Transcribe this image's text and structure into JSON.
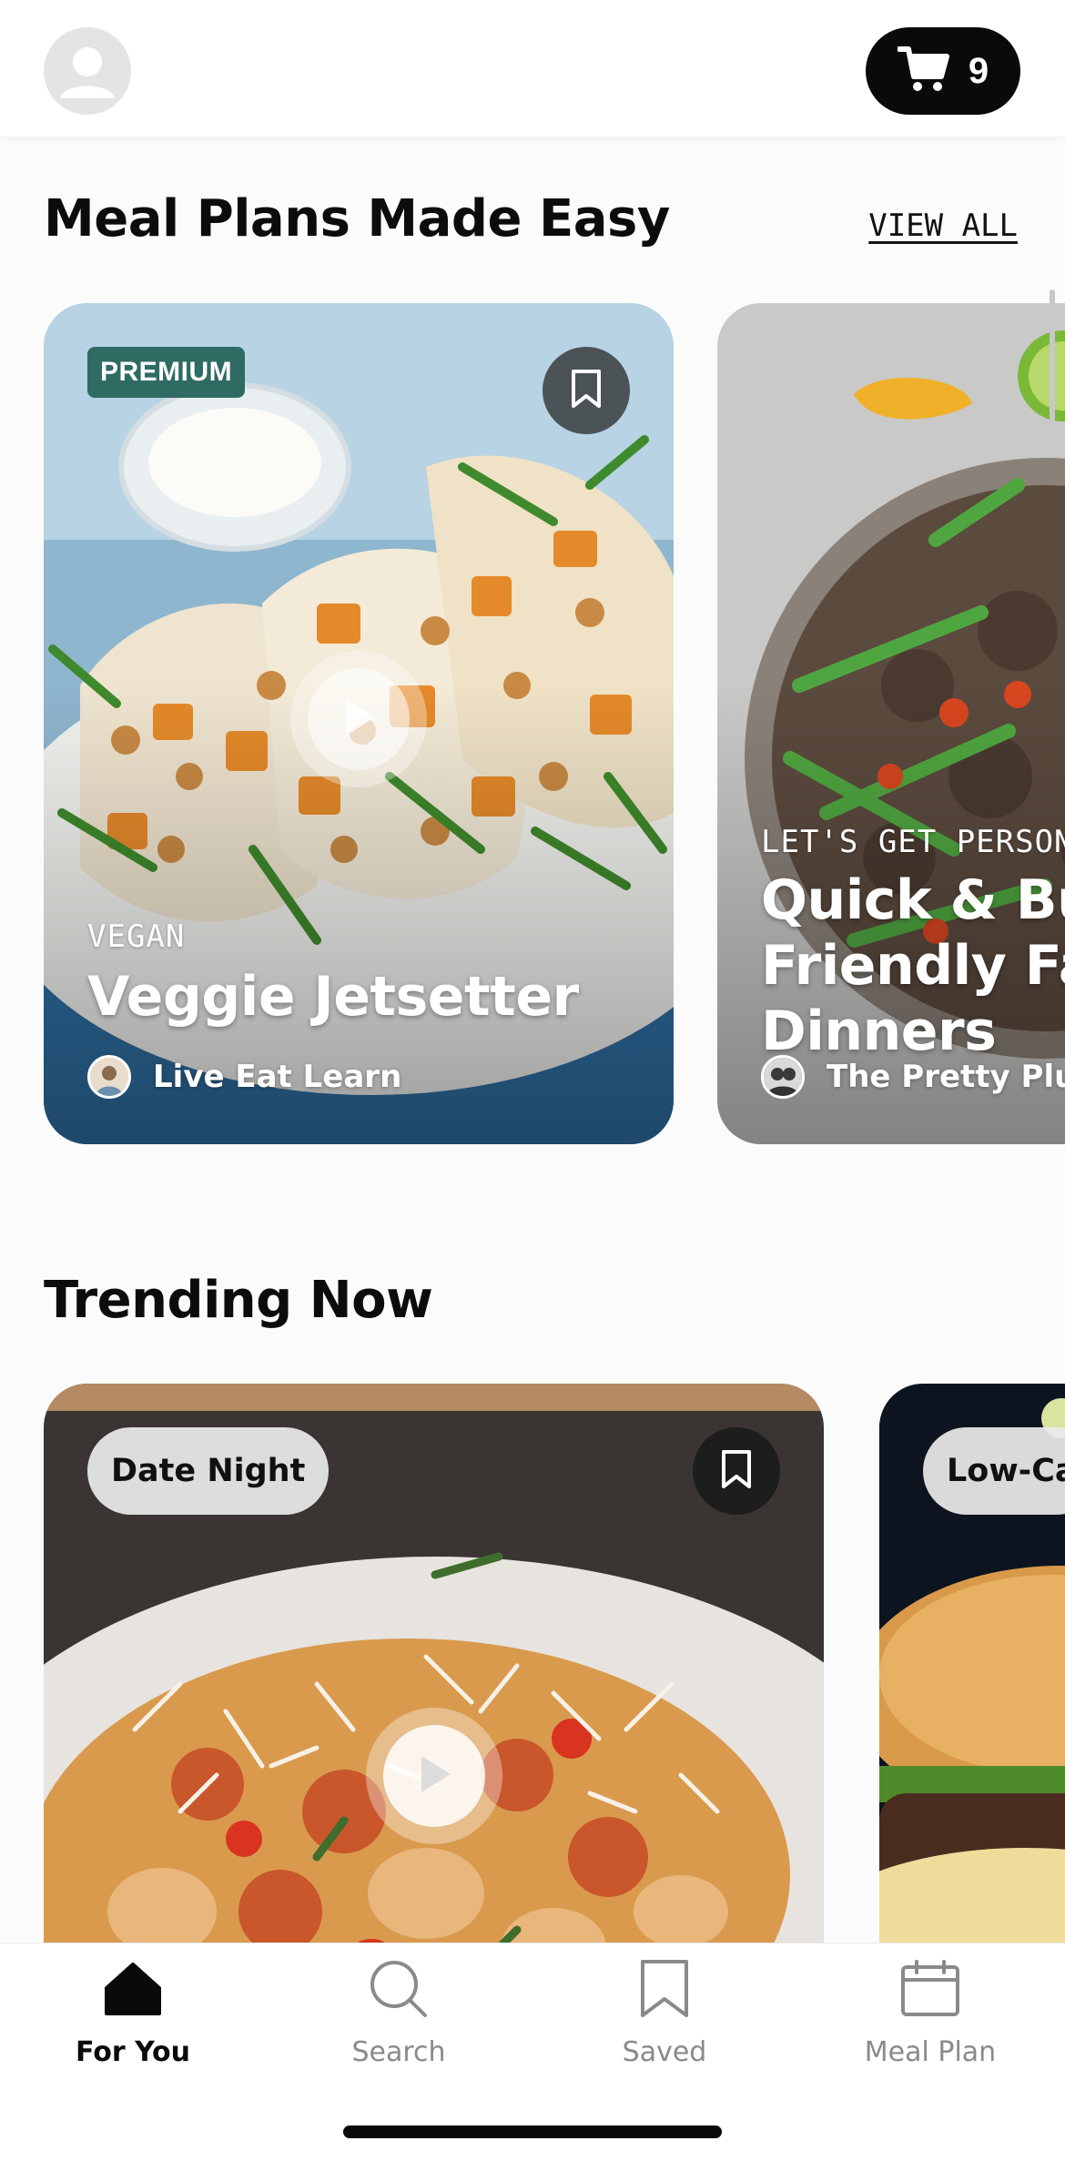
{
  "header": {
    "avatar_icon": "user-avatar-icon",
    "cart_icon": "cart-icon",
    "cart_count": "9"
  },
  "meal_plans": {
    "title": "Meal Plans Made Easy",
    "view_all": "VIEW ALL",
    "cards": [
      {
        "badge": "PREMIUM",
        "eyebrow": "VEGAN",
        "title": "Veggie Jetsetter",
        "author": "Live Eat Learn",
        "bookmark_icon": "bookmark-icon",
        "play_icon": "play-icon"
      },
      {
        "eyebrow": "LET'S GET PERSON",
        "title_lines": [
          "Quick & Bud",
          "Friendly Fan",
          "Dinners"
        ],
        "author": "The Pretty Plus"
      }
    ]
  },
  "trending": {
    "title": "Trending Now",
    "cards": [
      {
        "tag": "Date Night",
        "bookmark_icon": "bookmark-icon",
        "play_icon": "play-icon"
      },
      {
        "tag": "Low-Ca"
      }
    ]
  },
  "bottom_nav": {
    "items": [
      {
        "label": "For You",
        "icon": "home-icon",
        "active": true
      },
      {
        "label": "Search",
        "icon": "search-icon",
        "active": false
      },
      {
        "label": "Saved",
        "icon": "bookmark-icon",
        "active": false
      },
      {
        "label": "Meal Plan",
        "icon": "calendar-icon",
        "active": false
      }
    ]
  },
  "colors": {
    "accent": "#0a0a0a",
    "premium_badge": "#2f6b63",
    "inactive_nav": "#8a8a8a"
  }
}
